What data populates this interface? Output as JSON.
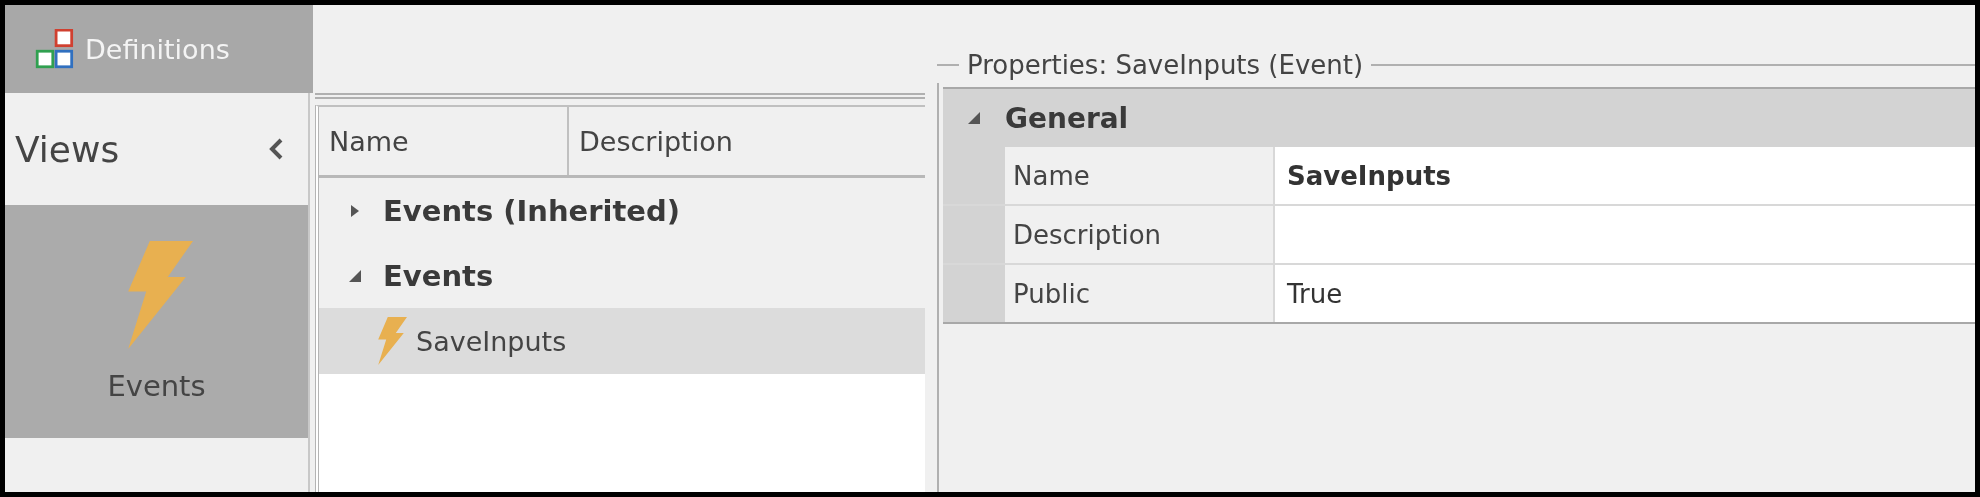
{
  "tab": {
    "label": "Definitions",
    "selected": true
  },
  "views": {
    "title": "Views",
    "items": [
      {
        "label": "Events",
        "selected": true
      }
    ]
  },
  "grid": {
    "columns": [
      "Name",
      "Description"
    ],
    "tree": [
      {
        "label": "Events (Inherited)",
        "expanded": false
      },
      {
        "label": "Events",
        "expanded": true,
        "children": [
          {
            "label": "SaveInputs",
            "selected": true
          }
        ]
      }
    ]
  },
  "properties": {
    "title": "Properties: SaveInputs (Event)",
    "category": {
      "label": "General",
      "expanded": true
    },
    "rows": [
      {
        "name": "Name",
        "value": "SaveInputs",
        "bold": true
      },
      {
        "name": "Description",
        "bold": false
      },
      {
        "name": "Public",
        "value": "True",
        "bold": false
      }
    ]
  }
}
